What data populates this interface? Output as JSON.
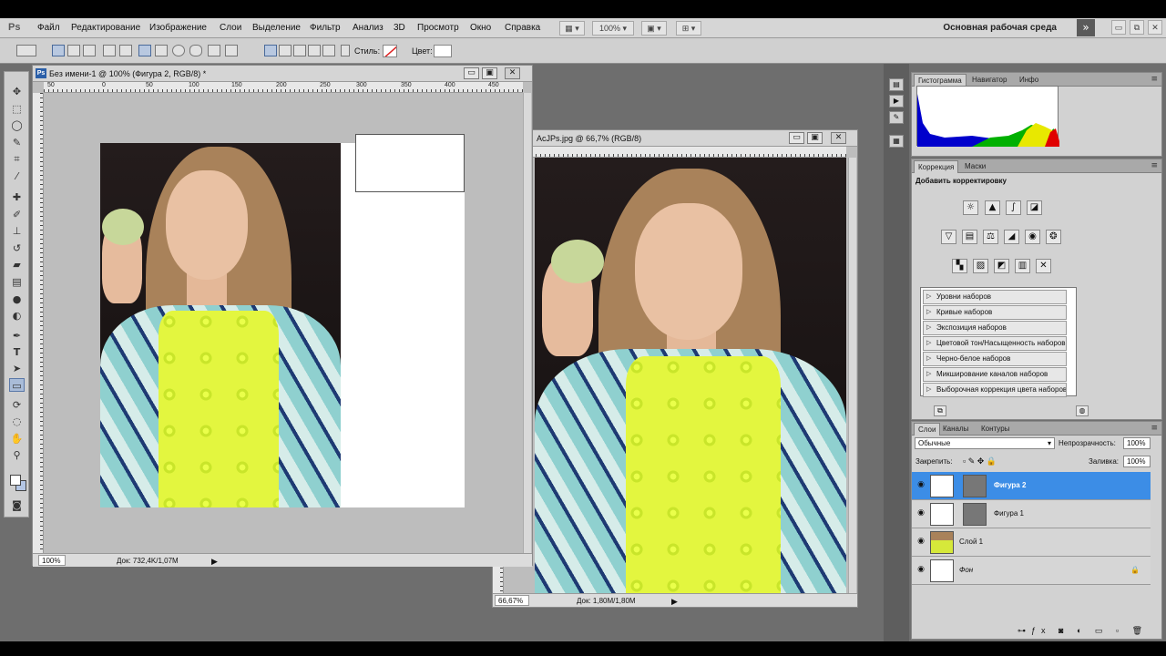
{
  "app": {
    "logo": "Ps"
  },
  "menu": [
    "Файл",
    "Редактирование",
    "Изображение",
    "Слои",
    "Выделение",
    "Фильтр",
    "Анализ",
    "3D",
    "Просмотр",
    "Окно",
    "Справка"
  ],
  "menu_bar_tools": {
    "zoom": "100%",
    "workspace": "Основная рабочая среда",
    "workspace_arrow": "»"
  },
  "options": {
    "style_label": "Стиль:",
    "color_label": "Цвет:"
  },
  "doc1": {
    "title": "Без имени-1 @ 100% (Фигура 2, RGB/8) *",
    "zoom": "100%",
    "doc_info": "Док: 732,4K/1,07M",
    "ruler": [
      "0",
      "50",
      "100",
      "150",
      "200",
      "250",
      "300",
      "350",
      "400",
      "450"
    ]
  },
  "doc2": {
    "title": "AcJPs.jpg @ 66,7% (RGB/8)",
    "zoom": "66,67%",
    "doc_info": "Док: 1,80M/1,80M"
  },
  "histogram_panel": {
    "tabs": [
      "Гистограмма",
      "Навигатор",
      "Инфо"
    ]
  },
  "adjust_panel": {
    "tabs": [
      "Коррекция",
      "Маски"
    ],
    "heading": "Добавить корректировку",
    "presets": [
      "Уровни наборов",
      "Кривые наборов",
      "Экспозиция наборов",
      "Цветовой тон/Насыщенность наборов",
      "Черно-белое наборов",
      "Микширование каналов наборов",
      "Выборочная коррекция цвета наборов"
    ]
  },
  "layers_panel": {
    "tabs": [
      "Слои",
      "Каналы",
      "Контуры"
    ],
    "blend_mode": "Обычные",
    "opacity_label": "Непрозрачность:",
    "opacity": "100%",
    "lock_label": "Закрепить:",
    "fill_label": "Заливка:",
    "fill": "100%",
    "layers": [
      "Фигура 2",
      "Фигура 1",
      "Слой 1",
      "Фон"
    ]
  },
  "colors": {
    "selection": "#3c8de6",
    "workspace": "#6e6e6e"
  }
}
